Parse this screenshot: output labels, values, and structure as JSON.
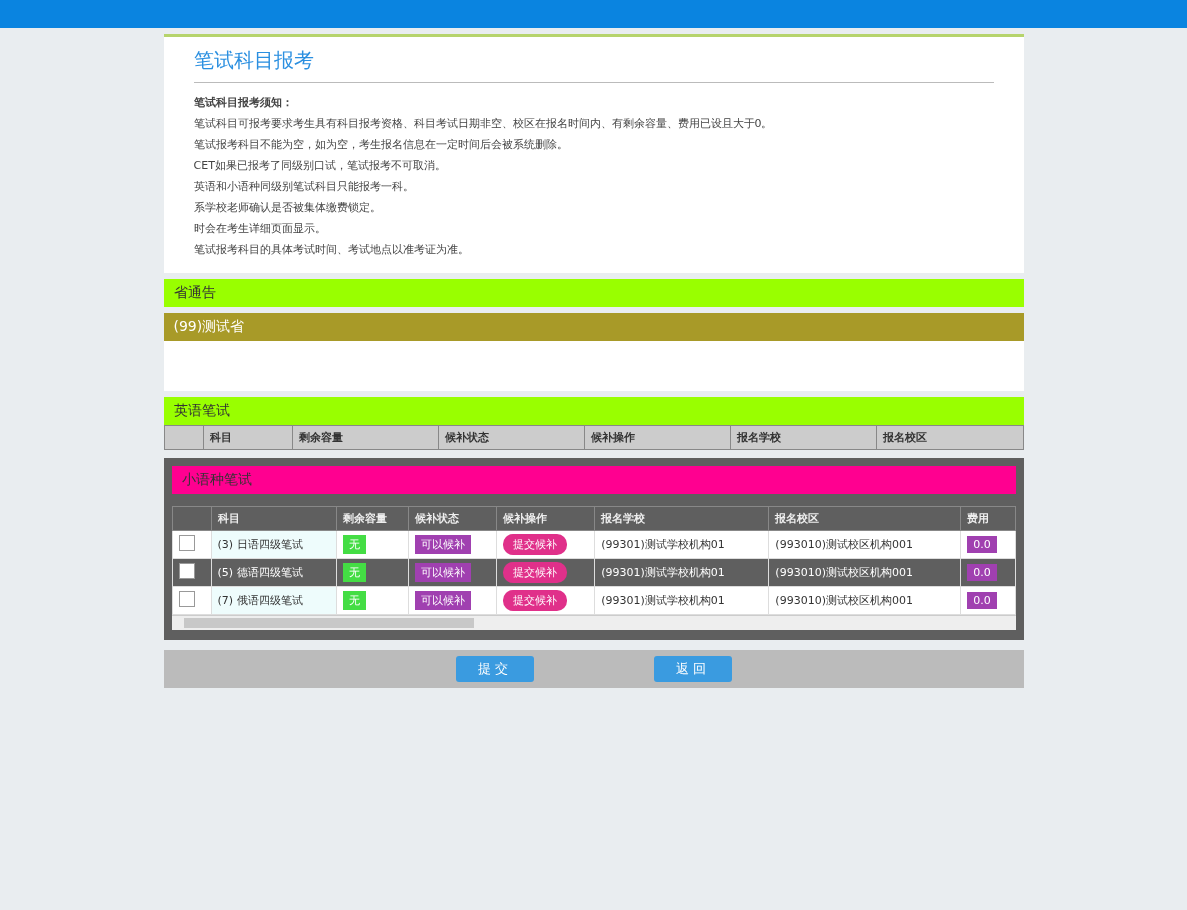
{
  "page": {
    "title": "笔试科目报考"
  },
  "notice": {
    "heading": "笔试科目报考须知：",
    "lines": [
      "笔试科目可报考要求考生具有科目报考资格、科目考试日期非空、校区在报名时间内、有剩余容量、费用已设且大于0。",
      "笔试报考科目不能为空，如为空，考生报名信息在一定时间后会被系统删除。",
      "CET如果已报考了同级别口试，笔试报考不可取消。",
      "英语和小语种同级别笔试科目只能报考一科。",
      "系学校老师确认是否被集体缴费锁定。",
      "时会在考生详细页面显示。",
      "笔试报考科目的具体考试时间、考试地点以准考证为准。"
    ]
  },
  "province_notice": {
    "heading": "省通告",
    "province": "(99)测试省"
  },
  "english_section": {
    "heading": "英语笔试",
    "columns": [
      "科目",
      "剩余容量",
      "候补状态",
      "候补操作",
      "报名学校",
      "报名校区"
    ]
  },
  "minor_section": {
    "heading": "小语种笔试",
    "columns": [
      "科目",
      "剩余容量",
      "候补状态",
      "候补操作",
      "报名学校",
      "报名校区",
      "费用"
    ],
    "rows": [
      {
        "checked": false,
        "selected": false,
        "subject": "(3) 日语四级笔试",
        "capacity": "无",
        "status": "可以候补",
        "action": "提交候补",
        "school": "(99301)测试学校机构01",
        "campus": "(993010)测试校区机构001",
        "fee": "0.0"
      },
      {
        "checked": false,
        "selected": true,
        "subject": "(5) 德语四级笔试",
        "capacity": "无",
        "status": "可以候补",
        "action": "提交候补",
        "school": "(99301)测试学校机构01",
        "campus": "(993010)测试校区机构001",
        "fee": "0.0"
      },
      {
        "checked": false,
        "selected": false,
        "subject": "(7) 俄语四级笔试",
        "capacity": "无",
        "status": "可以候补",
        "action": "提交候补",
        "school": "(99301)测试学校机构01",
        "campus": "(993010)测试校区机构001",
        "fee": "0.0"
      }
    ]
  },
  "buttons": [
    "提交",
    "返回"
  ]
}
